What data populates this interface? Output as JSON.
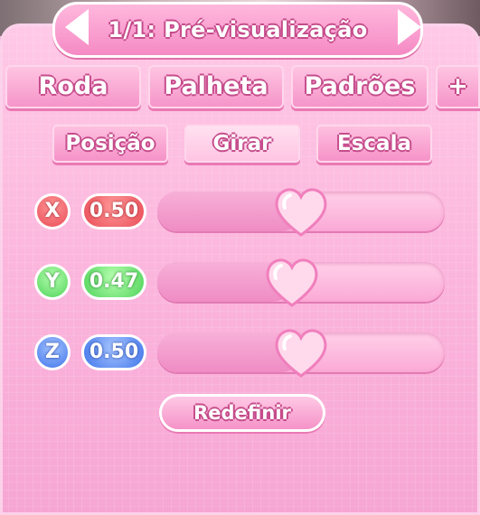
{
  "header": {
    "title": "1/1: Pré-visualização",
    "prev_icon": "arrow-left-icon",
    "next_icon": "arrow-right-icon"
  },
  "tabs": [
    {
      "label": "Roda"
    },
    {
      "label": "Palheta"
    },
    {
      "label": "Padrões"
    },
    {
      "label": "+"
    }
  ],
  "subtabs": [
    {
      "label": "Posição",
      "active": false
    },
    {
      "label": "Girar",
      "active": true
    },
    {
      "label": "Escala",
      "active": false
    }
  ],
  "axes": [
    {
      "label": "X",
      "value": "0.50",
      "fraction": 0.5,
      "color": "#e94b55"
    },
    {
      "label": "Y",
      "value": "0.47",
      "fraction": 0.47,
      "color": "#4fd35a"
    },
    {
      "label": "Z",
      "value": "0.50",
      "fraction": 0.5,
      "color": "#3f74ea"
    }
  ],
  "reset_label": "Redefinir",
  "colors": {
    "panel": "#fbb4dc",
    "accent": "#f58ac4",
    "outline": "#c54c8b"
  }
}
